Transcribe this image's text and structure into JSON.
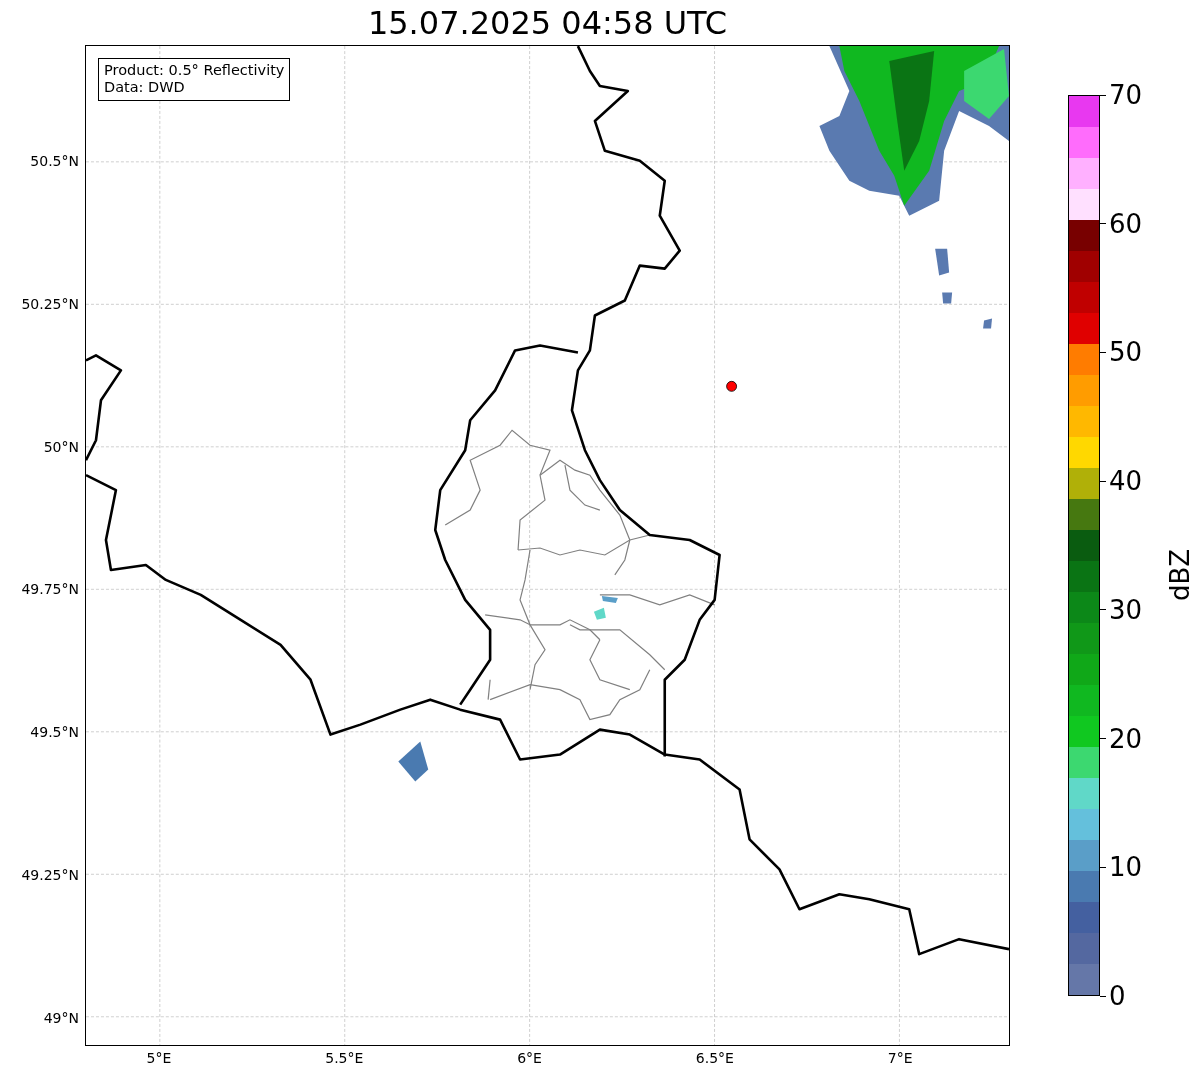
{
  "title": "15.07.2025 04:58 UTC",
  "map": {
    "info_box": [
      "Product: 0.5° Reflectivity",
      "Data: DWD"
    ],
    "y_ticks": [
      "50.5°N",
      "50.25°N",
      "50°N",
      "49.75°N",
      "49.5°N",
      "49.25°N",
      "49°N"
    ],
    "x_ticks": [
      "5°E",
      "5.5°E",
      "6°E",
      "6.5°E",
      "7°E"
    ]
  },
  "colorbar": {
    "label": "dBZ",
    "ticks": [
      "70",
      "60",
      "50",
      "40",
      "30",
      "20",
      "10",
      "0"
    ],
    "segments": [
      {
        "color": "#e838f0"
      },
      {
        "color": "#ff6cfc"
      },
      {
        "color": "#ffb0ff"
      },
      {
        "color": "#ffe0ff"
      },
      {
        "color": "#780000"
      },
      {
        "color": "#a00000"
      },
      {
        "color": "#c00000"
      },
      {
        "color": "#e00000"
      },
      {
        "color": "#ff7c00"
      },
      {
        "color": "#ff9c00"
      },
      {
        "color": "#ffb800"
      },
      {
        "color": "#ffd800"
      },
      {
        "color": "#b0b008"
      },
      {
        "color": "#467810"
      },
      {
        "color": "#0a5c10"
      },
      {
        "color": "#0a7414"
      },
      {
        "color": "#0c8818"
      },
      {
        "color": "#109818"
      },
      {
        "color": "#10a818"
      },
      {
        "color": "#10b820"
      },
      {
        "color": "#10c820"
      },
      {
        "color": "#3cd870"
      },
      {
        "color": "#60d8c8"
      },
      {
        "color": "#64c0dc"
      },
      {
        "color": "#5a9ec8"
      },
      {
        "color": "#4a7ab0"
      },
      {
        "color": "#4460a0"
      },
      {
        "color": "#5468a0"
      },
      {
        "color": "#6577a8"
      }
    ]
  }
}
